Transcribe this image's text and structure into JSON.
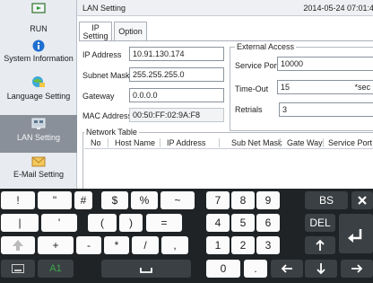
{
  "sidebar": {
    "items": [
      {
        "label": "RUN",
        "icon": "run-icon"
      },
      {
        "label": "System Information",
        "icon": "info-icon"
      },
      {
        "label": "Language Setting",
        "icon": "language-icon"
      },
      {
        "label": "LAN Setting",
        "icon": "lan-icon",
        "active": true
      },
      {
        "label": "E-Mail Setting",
        "icon": "email-icon"
      }
    ]
  },
  "header": {
    "title": "LAN Setting",
    "datetime": "2014-05-24 07:01:45"
  },
  "tabs": [
    {
      "label": "IP Setting",
      "active": true
    },
    {
      "label": "Option",
      "active": false
    }
  ],
  "form": {
    "ip_address": {
      "label": "IP Address",
      "value": "10.91.130.174"
    },
    "subnet_mask": {
      "label": "Subnet Mask",
      "value": "255.255.255.0"
    },
    "gateway": {
      "label": "Gateway",
      "value": "0.0.0.0"
    },
    "mac_address": {
      "label": "MAC Address",
      "value": "00:50:FF:02:9A:F8"
    }
  },
  "external_access": {
    "title": "External Access",
    "service_port": {
      "label": "Service Port",
      "value": "10000"
    },
    "timeout": {
      "label": "Time-Out",
      "value": "15",
      "unit": "*sec"
    },
    "retrials": {
      "label": "Retrials",
      "value": "3"
    }
  },
  "network_table": {
    "title": "Network Table",
    "columns": [
      "No",
      "Host Name",
      "IP Address",
      "Sub Net Mask",
      "Gate Way",
      "Service Port"
    ]
  },
  "keyboard": {
    "row1": [
      "!",
      "\"",
      "#",
      "$",
      "%",
      "~"
    ],
    "row2": [
      "|",
      "'",
      "(",
      ")",
      "="
    ],
    "row3": [
      "+",
      "-",
      "*",
      "/",
      ","
    ],
    "mode_label": "A1",
    "numbers": [
      "7",
      "8",
      "9",
      "4",
      "5",
      "6",
      "1",
      "2",
      "3",
      "0",
      "."
    ],
    "bs": "BS",
    "del": "DEL",
    "colors": {
      "background": "#1f2326",
      "key": "#fbfbfb",
      "key_dark": "#3b4044",
      "accent": "#3aa84a"
    }
  },
  "colors": {
    "sidebar_active": "#8a9099",
    "info_blue": "#1f6fd0",
    "sidebar_bg": "#e8ebf0"
  }
}
